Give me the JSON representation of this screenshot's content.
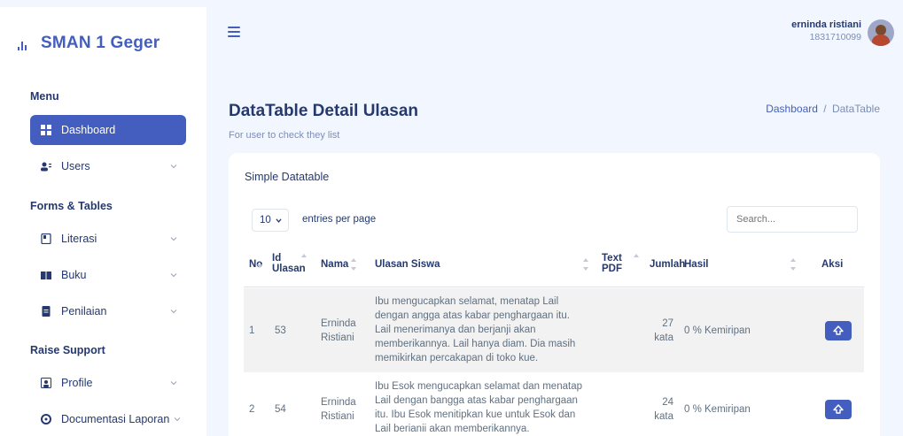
{
  "sidebar": {
    "brand": "SMAN 1 Geger",
    "sections": {
      "menu": "Menu",
      "forms": "Forms & Tables",
      "support": "Raise Support"
    },
    "items": [
      {
        "label": "Dashboard",
        "icon": "grid-icon"
      },
      {
        "label": "Users",
        "icon": "users-icon"
      },
      {
        "label": "Literasi",
        "icon": "book-open-icon"
      },
      {
        "label": "Buku",
        "icon": "book-icon"
      },
      {
        "label": "Penilaian",
        "icon": "file-icon"
      },
      {
        "label": "Profile",
        "icon": "profile-icon"
      },
      {
        "label": "Documentasi Laporan",
        "icon": "gear-icon"
      }
    ]
  },
  "header": {
    "user_name": "erninda ristiani",
    "user_id": "1831710099"
  },
  "page": {
    "title": "DataTable Detail Ulasan",
    "subtitle": "For user to check they list",
    "breadcrumb_home": "Dashboard",
    "breadcrumb_sep": "/",
    "breadcrumb_current": "DataTable"
  },
  "table": {
    "card_title": "Simple Datatable",
    "per_page_value": "10",
    "per_page_label": "entries per page",
    "search_placeholder": "Search...",
    "columns": {
      "no": "No",
      "id_ulasan_1": "Id",
      "id_ulasan_2": "Ulasan",
      "nama": "Nama",
      "ulasan_siswa": "Ulasan Siswa",
      "text_pdf_1": "Text",
      "text_pdf_2": "PDF",
      "jumlah": "Jumlah",
      "hasil": "Hasil",
      "aksi": "Aksi"
    },
    "rows": [
      {
        "no": "1",
        "id": "53",
        "nama_1": "Erninda",
        "nama_2": "Ristiani",
        "ulasan_lines": [
          "Ibu mengucapkan selamat, menatap Lail",
          "dengan angga atas kabar penghargaan itu.",
          "Lail menerimanya dan berjanji akan",
          "memberikannya. Lail hanya diam. Dia masih",
          "memikirkan percakapan di toko kue."
        ],
        "jumlah_1": "27",
        "jumlah_2": "kata",
        "hasil": "0 % Kemiripan"
      },
      {
        "no": "2",
        "id": "54",
        "nama_1": "Erninda",
        "nama_2": "Ristiani",
        "ulasan_lines": [
          "Ibu Esok mengucapkan selamat dan menatap",
          "Lail dengan bangga atas kabar penghargaan",
          "itu. Ibu Esok menitipkan kue untuk Esok dan",
          "Lail berianii akan memberikannya."
        ],
        "jumlah_1": "24",
        "jumlah_2": "kata",
        "hasil": "0 % Kemiripan"
      }
    ]
  },
  "colors": {
    "primary": "#435ebe",
    "text_dark": "#25396f",
    "text_muted": "#7c8db5",
    "background": "#f2f7ff"
  }
}
